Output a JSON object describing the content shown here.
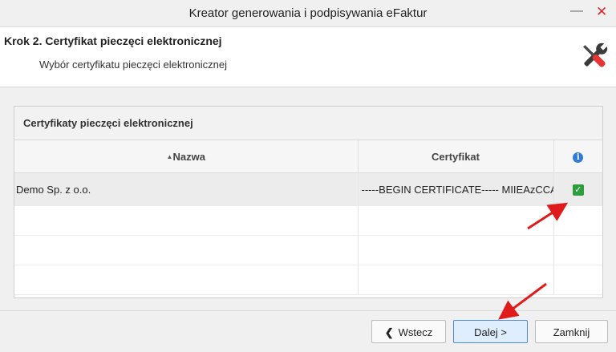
{
  "window": {
    "title": "Kreator generowania i podpisywania eFaktur",
    "minimize_glyph": "—",
    "close_glyph": "✕"
  },
  "header": {
    "step_title": "Krok 2. Certyfikat pieczęci elektronicznej",
    "step_subtitle": "Wybór certyfikatu pieczęci elektronicznej",
    "icon": "tools-icon"
  },
  "panel": {
    "title": "Certyfikaty pieczęci elektronicznej",
    "columns": {
      "name": "Nazwa",
      "name_sort_glyph": "▲",
      "certificate": "Certyfikat",
      "info_glyph": "i"
    },
    "rows": [
      {
        "name": "Demo Sp. z o.o.",
        "certificate": "-----BEGIN CERTIFICATE----- MIIEAzCCA",
        "checked": true,
        "check_glyph": "✓"
      }
    ]
  },
  "footer": {
    "back_glyph": "❮",
    "back_label": "Wstecz",
    "next_label": "Dalej >",
    "close_label": "Zamknij"
  },
  "colors": {
    "accent_blue": "#2f7bd6",
    "check_green": "#2e9d3e",
    "close_red": "#d62b2b",
    "annotation_red": "#e01b1b"
  }
}
